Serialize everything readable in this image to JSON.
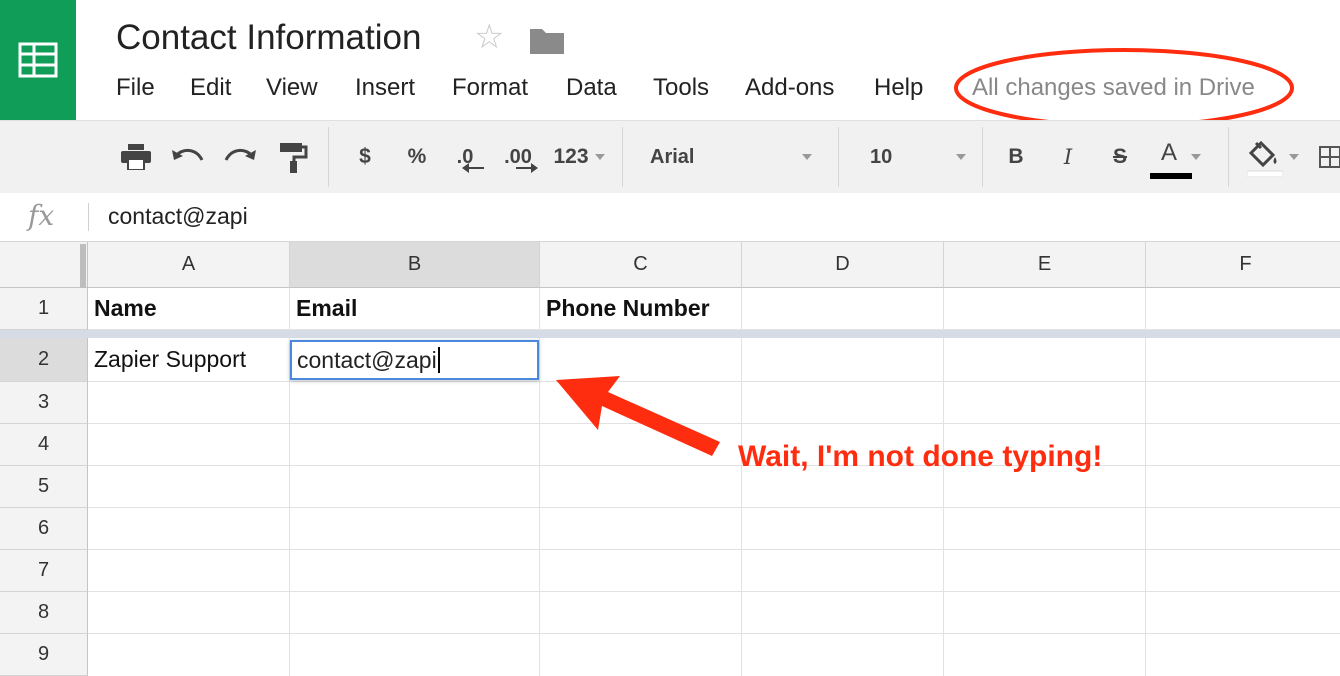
{
  "app": {
    "title": "Contact Information",
    "save_status": "All changes saved in Drive"
  },
  "menu": [
    "File",
    "Edit",
    "View",
    "Insert",
    "Format",
    "Data",
    "Tools",
    "Add-ons",
    "Help"
  ],
  "toolbar": {
    "currency": "$",
    "percent": "%",
    "decrease_decimal": ".0",
    "increase_decimal": ".00",
    "more_formats": "123",
    "font_family": "Arial",
    "font_size": "10",
    "bold": "B",
    "italic": "I",
    "strikethrough": "S",
    "text_color": "A",
    "icons": [
      "print-icon",
      "undo-icon",
      "redo-icon",
      "paint-format-icon",
      "fill-color-icon",
      "borders-icon"
    ]
  },
  "formula_bar": {
    "label": "fx",
    "value": "contact@zapi"
  },
  "grid": {
    "columns": [
      "A",
      "B",
      "C",
      "D",
      "E",
      "F"
    ],
    "rows": [
      "1",
      "2",
      "3",
      "4",
      "5",
      "6",
      "7",
      "8",
      "9"
    ],
    "cells": {
      "A1": "Name",
      "B1": "Email",
      "C1": "Phone Number",
      "A2": "Zapier Support",
      "B2": "contact@zapi"
    },
    "active_cell": "B2"
  },
  "annotation": {
    "text": "Wait, I'm not done typing!",
    "color": "#ff2d10"
  },
  "colors": {
    "brand": "#0f9d58",
    "selection": "#4a89dc"
  }
}
